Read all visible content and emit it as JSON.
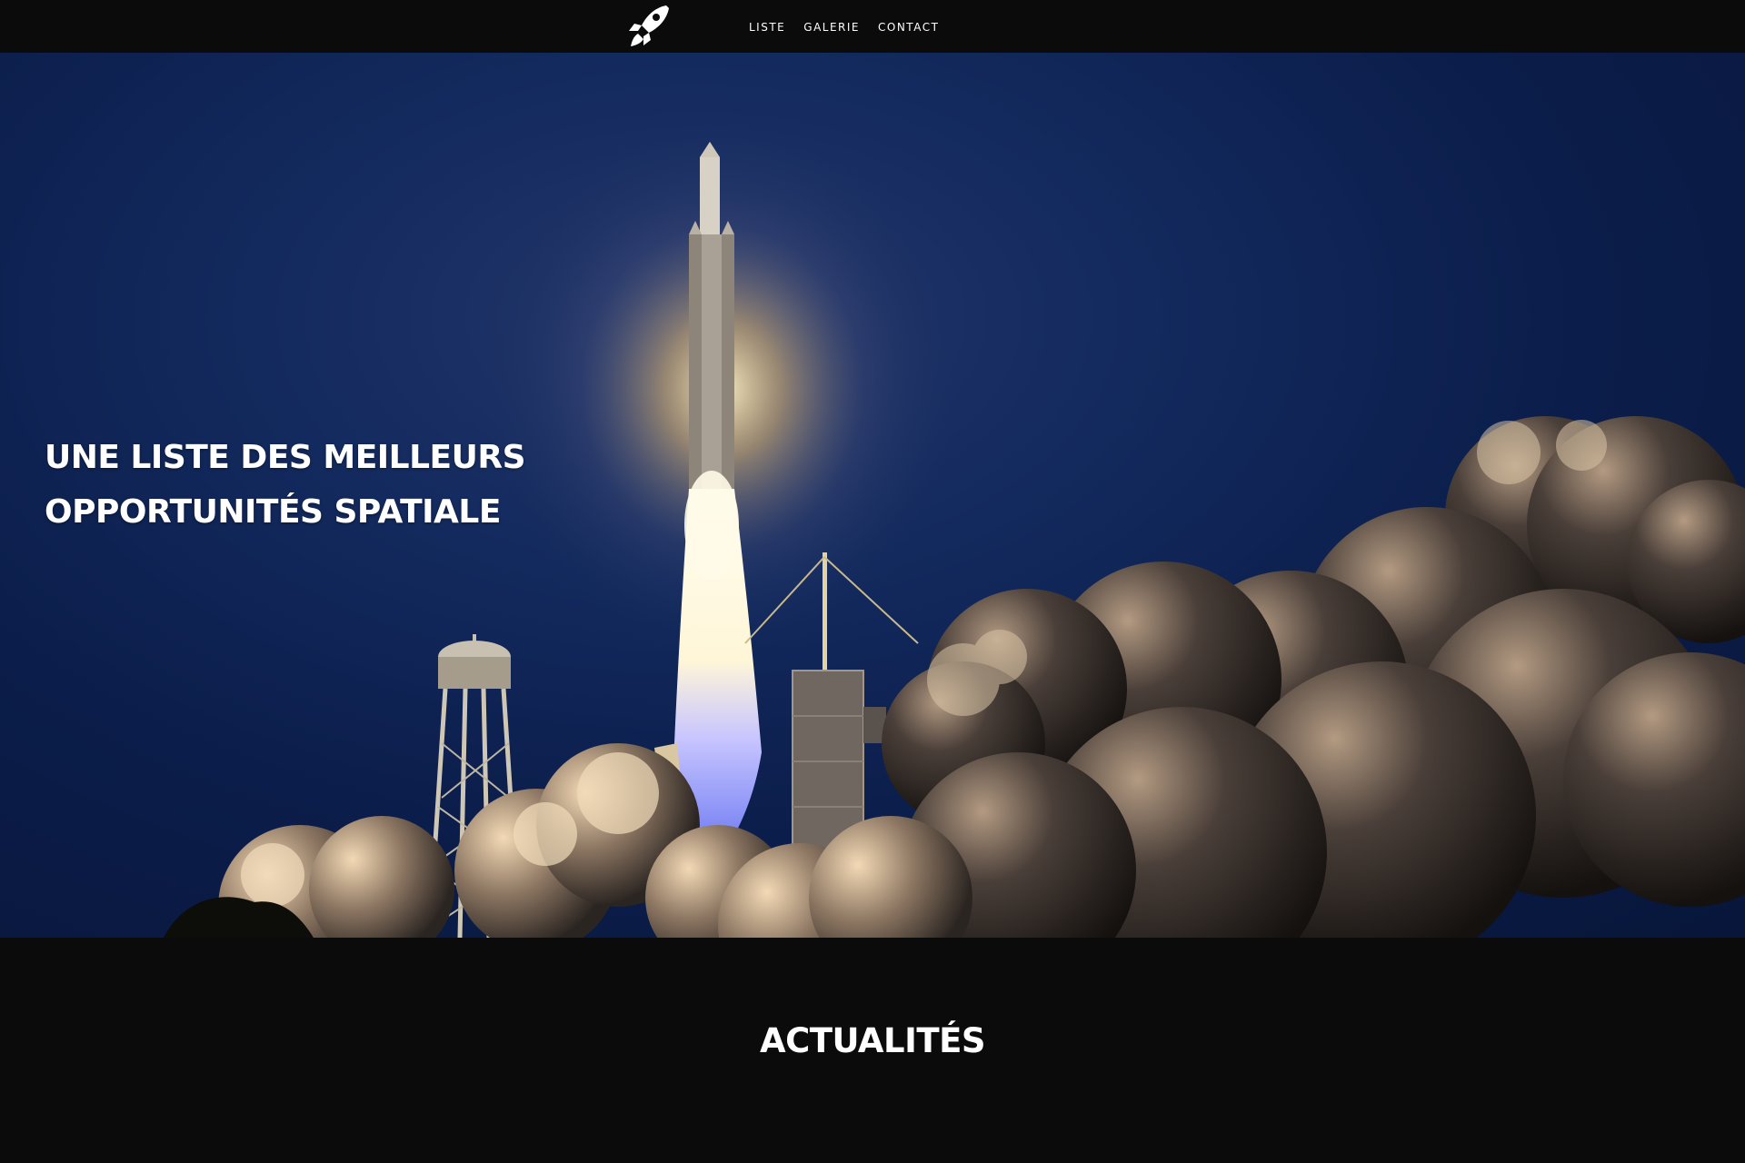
{
  "nav": {
    "logo_icon": "rocket-icon",
    "links": [
      {
        "label": "Liste"
      },
      {
        "label": "Galerie"
      },
      {
        "label": "Contact"
      }
    ]
  },
  "hero": {
    "title_line1": "UNE LISTE DES MEILLEURS",
    "title_line2": "OPPORTUNITÉS SPATIALE",
    "image": "rocket-launch-photo"
  },
  "news": {
    "title": "ACTUALITÉS"
  },
  "colors": {
    "background": "#0b0b0b",
    "text": "#ffffff",
    "sky": "#0b1d4a"
  }
}
